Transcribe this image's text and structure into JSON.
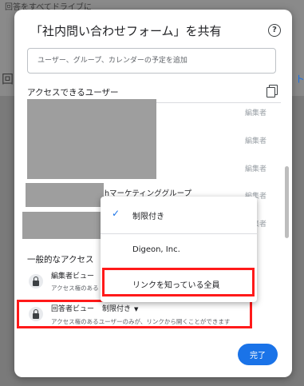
{
  "background": {
    "snippet_top": "回答をすべてドライブに",
    "snippet_left": "回",
    "snippet_right": "ト"
  },
  "dialog": {
    "title": "「社内問い合わせフォーム」を共有",
    "help_icon": "help-icon",
    "add_placeholder": "ユーザー、グループ、カレンダーの予定を追加",
    "access_users_title": "アクセスできるユーザー",
    "users": [
      {
        "role": "編集者"
      },
      {
        "role": "編集者"
      },
      {
        "role": "編集者"
      },
      {
        "name_suffix": "hマーケティンググループ",
        "role": "編集者"
      },
      {
        "role": "編集者"
      }
    ],
    "general_access_title": "一般的なアクセス",
    "editor_view": {
      "label": "編集者ビュー",
      "desc": "アクセス権のある"
    },
    "responder_view": {
      "label": "回答者ビュー",
      "setting": "制限付き",
      "desc": "アクセス権のあるユーザーのみが、リンクから開くことができます"
    },
    "done_label": "完了"
  },
  "menu": {
    "items": [
      "制限付き",
      "Digeon, Inc.",
      "リンクを知っている全員"
    ],
    "selected_index": 0
  },
  "colors": {
    "accent": "#1a73e8",
    "highlight": "#ff1a1a"
  }
}
